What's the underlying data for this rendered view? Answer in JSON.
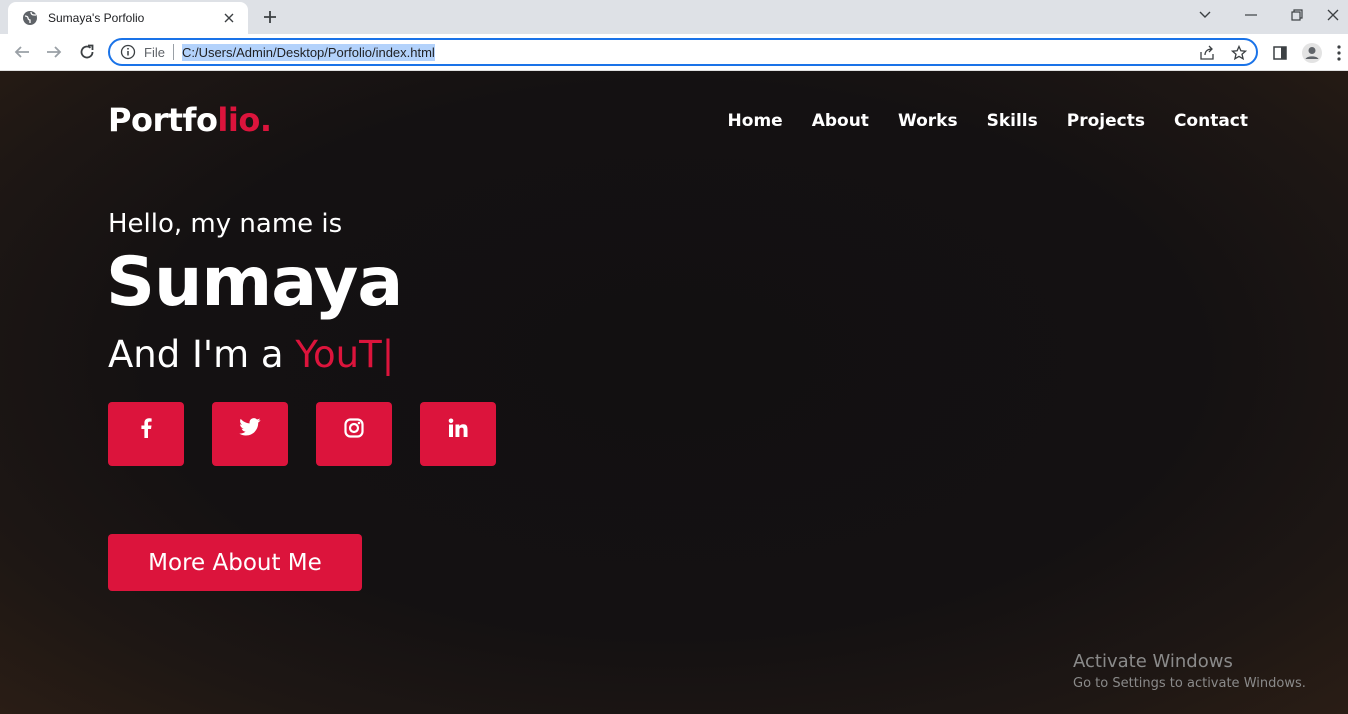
{
  "browser": {
    "tab_title": "Sumaya's Porfolio",
    "omnibox_scheme": "File",
    "url": "C:/Users/Admin/Desktop/Porfolio/index.html"
  },
  "site": {
    "logo_main": "Portfo",
    "logo_accent": "lio.",
    "nav": [
      "Home",
      "About",
      "Works",
      "Skills",
      "Projects",
      "Contact"
    ],
    "greeting": "Hello, my name is",
    "name": "Sumaya",
    "role_prefix": "And I'm a ",
    "role_typed": "YouT|",
    "socials": [
      "facebook-icon",
      "twitter-icon",
      "instagram-icon",
      "linkedin-icon"
    ],
    "cta_label": "More About Me"
  },
  "watermark": {
    "line1": "Activate Windows",
    "line2": "Go to Settings to activate Windows."
  },
  "colors": {
    "accent": "#dc143c",
    "background": "#141112",
    "text": "#ffffff"
  }
}
